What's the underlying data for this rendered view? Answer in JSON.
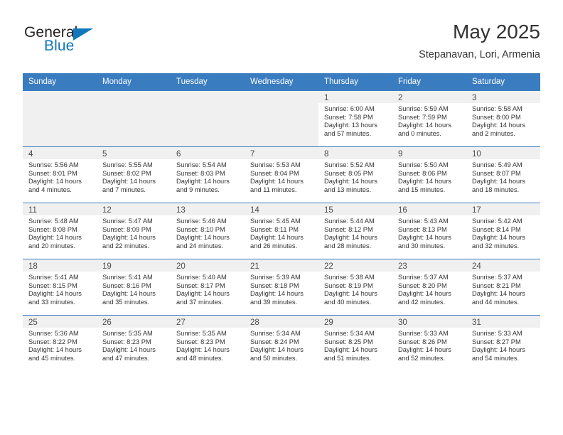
{
  "brand": {
    "name_top": "General",
    "name_bottom": "Blue",
    "accent_color": "#1277bc",
    "triangle_icon": "triangle-right-icon"
  },
  "header": {
    "title": "May 2025",
    "subtitle": "Stepanavan, Lori, Armenia"
  },
  "theme": {
    "header_bg": "#3a7cc0",
    "header_text": "#ffffff",
    "cell_alt_bg": "#f0f0f0",
    "cell_bg": "#ffffff"
  },
  "weekday_headers": [
    "Sunday",
    "Monday",
    "Tuesday",
    "Wednesday",
    "Thursday",
    "Friday",
    "Saturday"
  ],
  "weeks": [
    [
      {
        "day": "",
        "sunrise": "",
        "sunset": "",
        "daylight_line1": "",
        "daylight_line2": ""
      },
      {
        "day": "",
        "sunrise": "",
        "sunset": "",
        "daylight_line1": "",
        "daylight_line2": ""
      },
      {
        "day": "",
        "sunrise": "",
        "sunset": "",
        "daylight_line1": "",
        "daylight_line2": ""
      },
      {
        "day": "",
        "sunrise": "",
        "sunset": "",
        "daylight_line1": "",
        "daylight_line2": ""
      },
      {
        "day": "1",
        "sunrise": "Sunrise: 6:00 AM",
        "sunset": "Sunset: 7:58 PM",
        "daylight_line1": "Daylight: 13 hours",
        "daylight_line2": "and 57 minutes."
      },
      {
        "day": "2",
        "sunrise": "Sunrise: 5:59 AM",
        "sunset": "Sunset: 7:59 PM",
        "daylight_line1": "Daylight: 14 hours",
        "daylight_line2": "and 0 minutes."
      },
      {
        "day": "3",
        "sunrise": "Sunrise: 5:58 AM",
        "sunset": "Sunset: 8:00 PM",
        "daylight_line1": "Daylight: 14 hours",
        "daylight_line2": "and 2 minutes."
      }
    ],
    [
      {
        "day": "4",
        "sunrise": "Sunrise: 5:56 AM",
        "sunset": "Sunset: 8:01 PM",
        "daylight_line1": "Daylight: 14 hours",
        "daylight_line2": "and 4 minutes."
      },
      {
        "day": "5",
        "sunrise": "Sunrise: 5:55 AM",
        "sunset": "Sunset: 8:02 PM",
        "daylight_line1": "Daylight: 14 hours",
        "daylight_line2": "and 7 minutes."
      },
      {
        "day": "6",
        "sunrise": "Sunrise: 5:54 AM",
        "sunset": "Sunset: 8:03 PM",
        "daylight_line1": "Daylight: 14 hours",
        "daylight_line2": "and 9 minutes."
      },
      {
        "day": "7",
        "sunrise": "Sunrise: 5:53 AM",
        "sunset": "Sunset: 8:04 PM",
        "daylight_line1": "Daylight: 14 hours",
        "daylight_line2": "and 11 minutes."
      },
      {
        "day": "8",
        "sunrise": "Sunrise: 5:52 AM",
        "sunset": "Sunset: 8:05 PM",
        "daylight_line1": "Daylight: 14 hours",
        "daylight_line2": "and 13 minutes."
      },
      {
        "day": "9",
        "sunrise": "Sunrise: 5:50 AM",
        "sunset": "Sunset: 8:06 PM",
        "daylight_line1": "Daylight: 14 hours",
        "daylight_line2": "and 15 minutes."
      },
      {
        "day": "10",
        "sunrise": "Sunrise: 5:49 AM",
        "sunset": "Sunset: 8:07 PM",
        "daylight_line1": "Daylight: 14 hours",
        "daylight_line2": "and 18 minutes."
      }
    ],
    [
      {
        "day": "11",
        "sunrise": "Sunrise: 5:48 AM",
        "sunset": "Sunset: 8:08 PM",
        "daylight_line1": "Daylight: 14 hours",
        "daylight_line2": "and 20 minutes."
      },
      {
        "day": "12",
        "sunrise": "Sunrise: 5:47 AM",
        "sunset": "Sunset: 8:09 PM",
        "daylight_line1": "Daylight: 14 hours",
        "daylight_line2": "and 22 minutes."
      },
      {
        "day": "13",
        "sunrise": "Sunrise: 5:46 AM",
        "sunset": "Sunset: 8:10 PM",
        "daylight_line1": "Daylight: 14 hours",
        "daylight_line2": "and 24 minutes."
      },
      {
        "day": "14",
        "sunrise": "Sunrise: 5:45 AM",
        "sunset": "Sunset: 8:11 PM",
        "daylight_line1": "Daylight: 14 hours",
        "daylight_line2": "and 26 minutes."
      },
      {
        "day": "15",
        "sunrise": "Sunrise: 5:44 AM",
        "sunset": "Sunset: 8:12 PM",
        "daylight_line1": "Daylight: 14 hours",
        "daylight_line2": "and 28 minutes."
      },
      {
        "day": "16",
        "sunrise": "Sunrise: 5:43 AM",
        "sunset": "Sunset: 8:13 PM",
        "daylight_line1": "Daylight: 14 hours",
        "daylight_line2": "and 30 minutes."
      },
      {
        "day": "17",
        "sunrise": "Sunrise: 5:42 AM",
        "sunset": "Sunset: 8:14 PM",
        "daylight_line1": "Daylight: 14 hours",
        "daylight_line2": "and 32 minutes."
      }
    ],
    [
      {
        "day": "18",
        "sunrise": "Sunrise: 5:41 AM",
        "sunset": "Sunset: 8:15 PM",
        "daylight_line1": "Daylight: 14 hours",
        "daylight_line2": "and 33 minutes."
      },
      {
        "day": "19",
        "sunrise": "Sunrise: 5:41 AM",
        "sunset": "Sunset: 8:16 PM",
        "daylight_line1": "Daylight: 14 hours",
        "daylight_line2": "and 35 minutes."
      },
      {
        "day": "20",
        "sunrise": "Sunrise: 5:40 AM",
        "sunset": "Sunset: 8:17 PM",
        "daylight_line1": "Daylight: 14 hours",
        "daylight_line2": "and 37 minutes."
      },
      {
        "day": "21",
        "sunrise": "Sunrise: 5:39 AM",
        "sunset": "Sunset: 8:18 PM",
        "daylight_line1": "Daylight: 14 hours",
        "daylight_line2": "and 39 minutes."
      },
      {
        "day": "22",
        "sunrise": "Sunrise: 5:38 AM",
        "sunset": "Sunset: 8:19 PM",
        "daylight_line1": "Daylight: 14 hours",
        "daylight_line2": "and 40 minutes."
      },
      {
        "day": "23",
        "sunrise": "Sunrise: 5:37 AM",
        "sunset": "Sunset: 8:20 PM",
        "daylight_line1": "Daylight: 14 hours",
        "daylight_line2": "and 42 minutes."
      },
      {
        "day": "24",
        "sunrise": "Sunrise: 5:37 AM",
        "sunset": "Sunset: 8:21 PM",
        "daylight_line1": "Daylight: 14 hours",
        "daylight_line2": "and 44 minutes."
      }
    ],
    [
      {
        "day": "25",
        "sunrise": "Sunrise: 5:36 AM",
        "sunset": "Sunset: 8:22 PM",
        "daylight_line1": "Daylight: 14 hours",
        "daylight_line2": "and 45 minutes."
      },
      {
        "day": "26",
        "sunrise": "Sunrise: 5:35 AM",
        "sunset": "Sunset: 8:23 PM",
        "daylight_line1": "Daylight: 14 hours",
        "daylight_line2": "and 47 minutes."
      },
      {
        "day": "27",
        "sunrise": "Sunrise: 5:35 AM",
        "sunset": "Sunset: 8:23 PM",
        "daylight_line1": "Daylight: 14 hours",
        "daylight_line2": "and 48 minutes."
      },
      {
        "day": "28",
        "sunrise": "Sunrise: 5:34 AM",
        "sunset": "Sunset: 8:24 PM",
        "daylight_line1": "Daylight: 14 hours",
        "daylight_line2": "and 50 minutes."
      },
      {
        "day": "29",
        "sunrise": "Sunrise: 5:34 AM",
        "sunset": "Sunset: 8:25 PM",
        "daylight_line1": "Daylight: 14 hours",
        "daylight_line2": "and 51 minutes."
      },
      {
        "day": "30",
        "sunrise": "Sunrise: 5:33 AM",
        "sunset": "Sunset: 8:26 PM",
        "daylight_line1": "Daylight: 14 hours",
        "daylight_line2": "and 52 minutes."
      },
      {
        "day": "31",
        "sunrise": "Sunrise: 5:33 AM",
        "sunset": "Sunset: 8:27 PM",
        "daylight_line1": "Daylight: 14 hours",
        "daylight_line2": "and 54 minutes."
      }
    ]
  ]
}
